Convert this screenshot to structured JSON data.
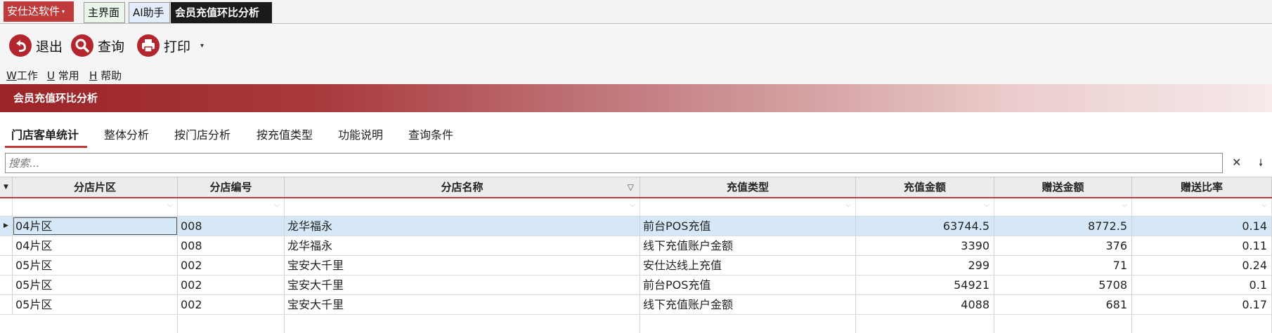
{
  "app": {
    "menu_label": "安仕达软件",
    "menu_caret": "▾"
  },
  "tabs": [
    {
      "label": "主界面"
    },
    {
      "label": "AI助手"
    },
    {
      "label": "会员充值环比分析"
    }
  ],
  "toolbar": {
    "exit_label": "退出",
    "query_label": "查询",
    "print_label": "打印",
    "print_dropdown": "▾"
  },
  "menus": [
    {
      "key": "W",
      "label": "工作"
    },
    {
      "key": "U",
      "label": "常用"
    },
    {
      "key": "H",
      "label": "帮助"
    }
  ],
  "section": {
    "title": "会员充值环比分析"
  },
  "subtabs": [
    {
      "label": "门店客单统计"
    },
    {
      "label": "整体分析"
    },
    {
      "label": "按门店分析"
    },
    {
      "label": "按充值类型"
    },
    {
      "label": "功能说明"
    },
    {
      "label": "查询条件"
    }
  ],
  "search": {
    "placeholder": "搜索...",
    "clear": "✕",
    "pin": "🠗"
  },
  "grid": {
    "columns": [
      "分店片区",
      "分店编号",
      "分店名称",
      "充值类型",
      "充值金额",
      "赠送金额",
      "赠送比率"
    ],
    "rows": [
      [
        "04片区",
        "008",
        "龙华福永",
        "前台POS充值",
        "63744.5",
        "8772.5",
        "0.14"
      ],
      [
        "04片区",
        "008",
        "龙华福永",
        "线下充值账户金额",
        "3390",
        "376",
        "0.11"
      ],
      [
        "05片区",
        "002",
        "宝安大千里",
        "安仕达线上充值",
        "299",
        "71",
        "0.24"
      ],
      [
        "05片区",
        "002",
        "宝安大千里",
        "前台POS充值",
        "54921",
        "5708",
        "0.1"
      ],
      [
        "05片区",
        "002",
        "宝安大千里",
        "线下充值账户金额",
        "4088",
        "681",
        "0.17"
      ]
    ]
  }
}
